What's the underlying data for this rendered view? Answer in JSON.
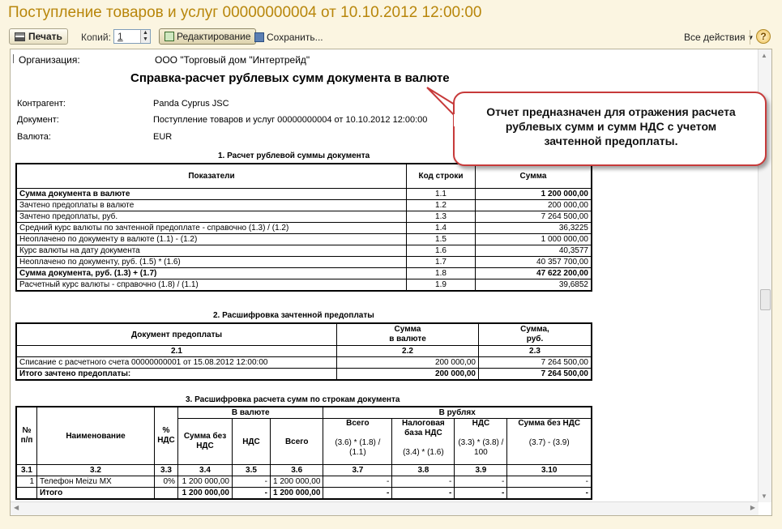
{
  "window": {
    "title": "Поступление товаров и услуг 00000000004 от 10.10.2012 12:00:00"
  },
  "toolbar": {
    "print": "Печать",
    "copies_label": "Копий:",
    "copies_value": "1",
    "edit": "Редактирование",
    "save": "Сохранить...",
    "all_actions": "Все действия",
    "help": "?"
  },
  "header": {
    "org_label": "Организация:",
    "org_value": "ООО \"Торговый дом \"Интертрейд\"",
    "report_title": "Справка-расчет рублевых сумм документа в валюте",
    "counterparty_label": "Контрагент:",
    "counterparty_value": "Panda Cyprus JSC",
    "document_label": "Документ:",
    "document_value": "Поступление товаров и услуг 00000000004 от 10.10.2012 12:00:00",
    "currency_label": "Валюта:",
    "currency_value": "EUR"
  },
  "callout": {
    "text": "Отчет предназначен для отражения расчета рублевых сумм и сумм НДС с учетом зачтенной предоплаты."
  },
  "section1": {
    "title": "1. Расчет рублевой суммы документа",
    "headers": [
      "Показатели",
      "Код строки",
      "Сумма"
    ],
    "rows": [
      {
        "name": "Сумма документа в валюте",
        "code": "1.1",
        "sum": "1 200 000,00"
      },
      {
        "name": "Зачтено предоплаты в валюте",
        "code": "1.2",
        "sum": "200 000,00"
      },
      {
        "name": "Зачтено предоплаты, руб.",
        "code": "1.3",
        "sum": "7 264 500,00"
      },
      {
        "name": "Средний курс валюты по зачтенной предоплате - справочно  (1.3) / (1.2)",
        "code": "1.4",
        "sum": "36,3225"
      },
      {
        "name": "Неоплачено по документу в валюте  (1.1) - (1.2)",
        "code": "1.5",
        "sum": "1 000 000,00"
      },
      {
        "name": "Курс валюты на дату документа",
        "code": "1.6",
        "sum": "40,3577"
      },
      {
        "name": "Неоплачено по документу, руб. (1.5) * (1.6)",
        "code": "1.7",
        "sum": "40 357 700,00"
      },
      {
        "name": "Сумма документа, руб. (1.3) + (1.7)",
        "code": "1.8",
        "sum": "47 622 200,00"
      },
      {
        "name": "Расчетный курс валюты - справочно (1.8) / (1.1)",
        "code": "1.9",
        "sum": "39,6852"
      }
    ]
  },
  "section2": {
    "title": "2. Расшифровка зачтенной предоплаты",
    "h_doc": "Документ предоплаты",
    "h_cur1": "Сумма",
    "h_cur2": "в валюте",
    "h_rub1": "Сумма,",
    "h_rub2": "руб.",
    "n1": "2.1",
    "n2": "2.2",
    "n3": "2.3",
    "row_doc": "Списание с расчетного счета 00000000001 от 15.08.2012 12:00:00",
    "row_cur": "200 000,00",
    "row_rub": "7 264 500,00",
    "total_label": "Итого зачтено предоплаты:",
    "total_cur": "200 000,00",
    "total_rub": "7 264 500,00"
  },
  "section3": {
    "title": "3. Расшифровка расчета сумм по строкам документа",
    "h_no": "№ п/п",
    "h_name": "Наименование",
    "h_vat_pct": "% НДС",
    "h_in_cur": "В валюте",
    "h_in_rub": "В рублях",
    "h_sum_wo_vat": "Сумма без НДС",
    "h_vat": "НДС",
    "h_total": "Всего",
    "h_rub_total": "Всего",
    "h_rub_total_f": "(3.6) * (1.8) / (1.1)",
    "h_tax_base": "Налоговая база НДС",
    "h_tax_base_f": "(3.4) * (1.6)",
    "h_rub_vat": "НДС",
    "h_rub_vat_f": "(3.3) * (3.8) / 100",
    "h_rub_wo_vat": "Сумма без НДС",
    "h_rub_wo_vat_f": "(3.7) - (3.9)",
    "nums": [
      "3.1",
      "3.2",
      "3.3",
      "3.4",
      "3.5",
      "3.6",
      "3.7",
      "3.8",
      "3.9",
      "3.10"
    ],
    "row": {
      "no": "1",
      "name": "Телефон Meizu MX",
      "vat_pct": "0%",
      "sum_wo_vat": "1 200 000,00",
      "vat": "-",
      "total": "1 200 000,00",
      "r1": "-",
      "r2": "-",
      "r3": "-",
      "r4": "-"
    },
    "total": {
      "label": "Итого",
      "sum_wo_vat": "1 200 000,00",
      "vat": "-",
      "total": "1 200 000,00",
      "r1": "-",
      "r2": "-",
      "r3": "-",
      "r4": "-"
    }
  }
}
